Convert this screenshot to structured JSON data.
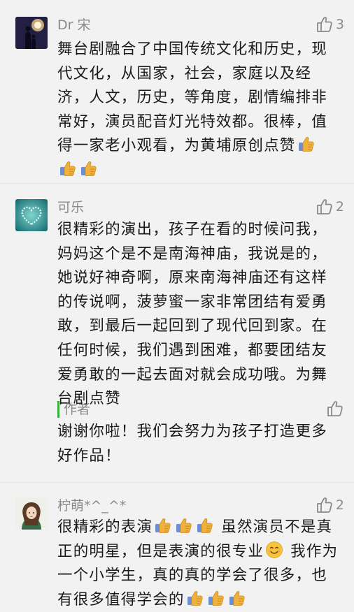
{
  "comments": [
    {
      "name": "Dr 宋",
      "likes": "3",
      "text": "舞台剧融合了中国传统文化和历史，现代文化，从国家，社会，家庭以及经济，人文，历史，等角度，剧情编排非常好，演员配音灯光特效都。很棒，值得一家老小观看，为黄埔原创点赞",
      "emoji": [
        "thumbs-up",
        "thumbs-up",
        "thumbs-up"
      ]
    },
    {
      "name": "可乐",
      "likes": "2",
      "text": "很精彩的演出，孩子在看的时候问我，妈妈这个是不是南海神庙，我说是的，她说好神奇啊，原来南海神庙还有这样的传说啊，菠萝蜜一家非常团结有爱勇敢，到最后一起回到了现代回到家。在任何时候，我们遇到困难，都要团结友爱勇敢的一起去面对就会成功哦。为舞台剧点赞",
      "reply": {
        "label": "作者",
        "text": "谢谢你啦！我们会努力为孩子打造更多好作品！"
      }
    },
    {
      "name": "柠萌*^_^*",
      "likes": "2",
      "text_a": "很精彩的表演",
      "text_b": "虽然演员不是真正的明星，但是表演的很专业",
      "text_c": "我作为一个小学生，真的真的学会了很多，也有很多值得学会的"
    }
  ],
  "colors": {
    "background": "#f2f2f2",
    "meta_text": "#8a8a8a",
    "author_accent": "#38b03d",
    "thumb_emoji": "#f0b23c"
  }
}
